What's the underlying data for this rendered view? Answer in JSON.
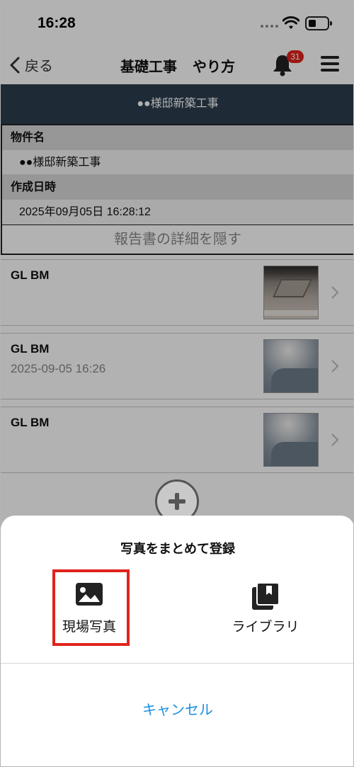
{
  "status_bar": {
    "time": "16:28"
  },
  "nav": {
    "back_label": "戻る",
    "title_part1": "基礎工事",
    "title_part2": "やり方",
    "notification_count": "31"
  },
  "project": {
    "banner": "●●様邸新築工事"
  },
  "details": {
    "property_label": "物件名",
    "property_value": "●●様邸新築工事",
    "created_label": "作成日時",
    "created_value": "2025年09月05日 16:28:12"
  },
  "toggle_details_label": "報告書の詳細を隠す",
  "report_items": [
    {
      "title": "GL BM",
      "subtitle": ""
    },
    {
      "title": "GL BM",
      "subtitle": "2025-09-05 16:26"
    },
    {
      "title": "GL BM",
      "subtitle": ""
    }
  ],
  "sheet": {
    "title": "写真をまとめて登録",
    "option_site_photo": "現場写真",
    "option_library": "ライブラリ",
    "cancel_label": "キャンセル"
  },
  "colors": {
    "header_band": "#2c3e50",
    "badge": "#e0231c",
    "highlight": "#e0231c",
    "cancel_link": "#1a8fe0"
  },
  "icons": {
    "back": "chevron-left-icon",
    "bell": "bell-icon",
    "menu": "hamburger-menu-icon",
    "photo": "image-icon",
    "library": "photo-library-icon",
    "add": "plus-circle-icon",
    "row_chevron": "chevron-right-icon"
  }
}
